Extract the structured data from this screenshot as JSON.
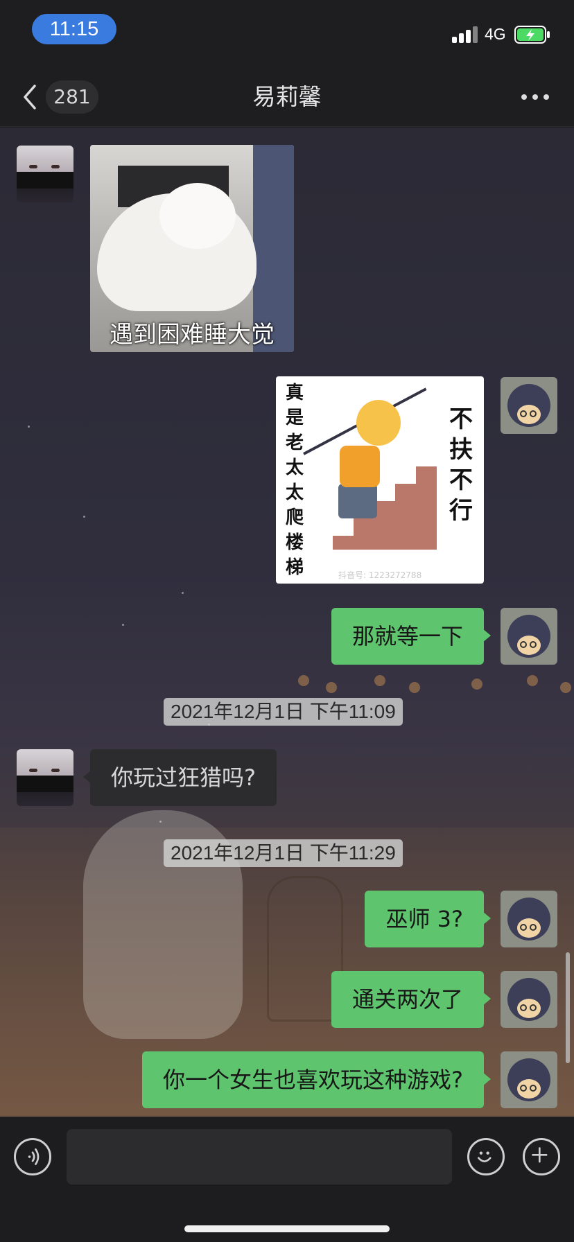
{
  "status_bar": {
    "time": "11:15",
    "network": "4G"
  },
  "nav": {
    "unread_count": "281",
    "title": "易莉馨"
  },
  "messages": [
    {
      "sender": "contact",
      "type": "image",
      "caption": "遇到困难睡大觉"
    },
    {
      "sender": "me",
      "type": "image",
      "left_text": "真是老太太爬楼梯",
      "right_text": "不扶不行",
      "watermark": "抖音号: 1223272788"
    },
    {
      "sender": "me",
      "type": "text",
      "text": "那就等一下"
    },
    {
      "type": "timestamp",
      "text": "2021年12月1日 下午11:09"
    },
    {
      "sender": "contact",
      "type": "text",
      "text": "你玩过狂猎吗?"
    },
    {
      "type": "timestamp",
      "text": "2021年12月1日 下午11:29"
    },
    {
      "sender": "me",
      "type": "text",
      "text": "巫师 3?"
    },
    {
      "sender": "me",
      "type": "text",
      "text": "通关两次了"
    },
    {
      "sender": "me",
      "type": "text",
      "text": "你一个女生也喜欢玩这种游戏?"
    }
  ],
  "icons": {
    "back": "chevron-left-icon",
    "more": "more-dots-icon",
    "voice": "voice-icon",
    "emoji": "emoji-icon",
    "plus": "plus-icon"
  },
  "colors": {
    "my_bubble": "#5ec46e",
    "contact_bubble": "#2c2c2f",
    "time_pill": "#3a7be0"
  }
}
